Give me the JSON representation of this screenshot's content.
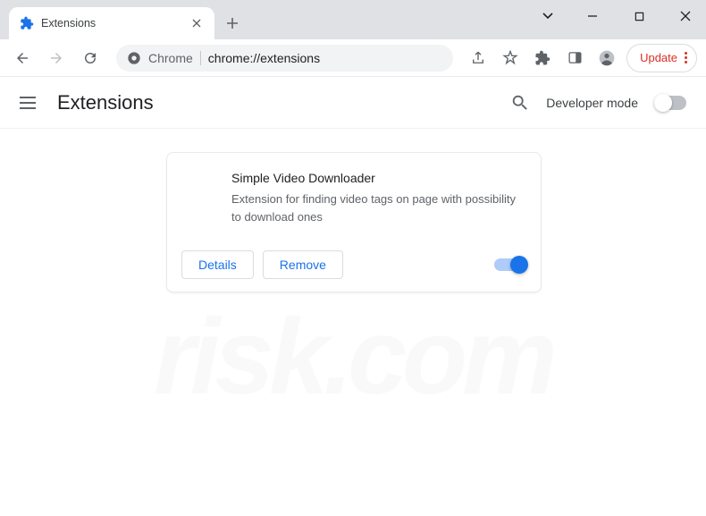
{
  "window": {
    "tab_title": "Extensions"
  },
  "toolbar": {
    "url_prefix": "Chrome",
    "url": "chrome://extensions",
    "update_label": "Update"
  },
  "page": {
    "title": "Extensions",
    "dev_mode_label": "Developer mode",
    "dev_mode_on": false
  },
  "extension": {
    "name": "Simple Video Downloader",
    "description": "Extension for finding video tags on page with possibility to download ones",
    "enabled": true,
    "details_label": "Details",
    "remove_label": "Remove"
  }
}
